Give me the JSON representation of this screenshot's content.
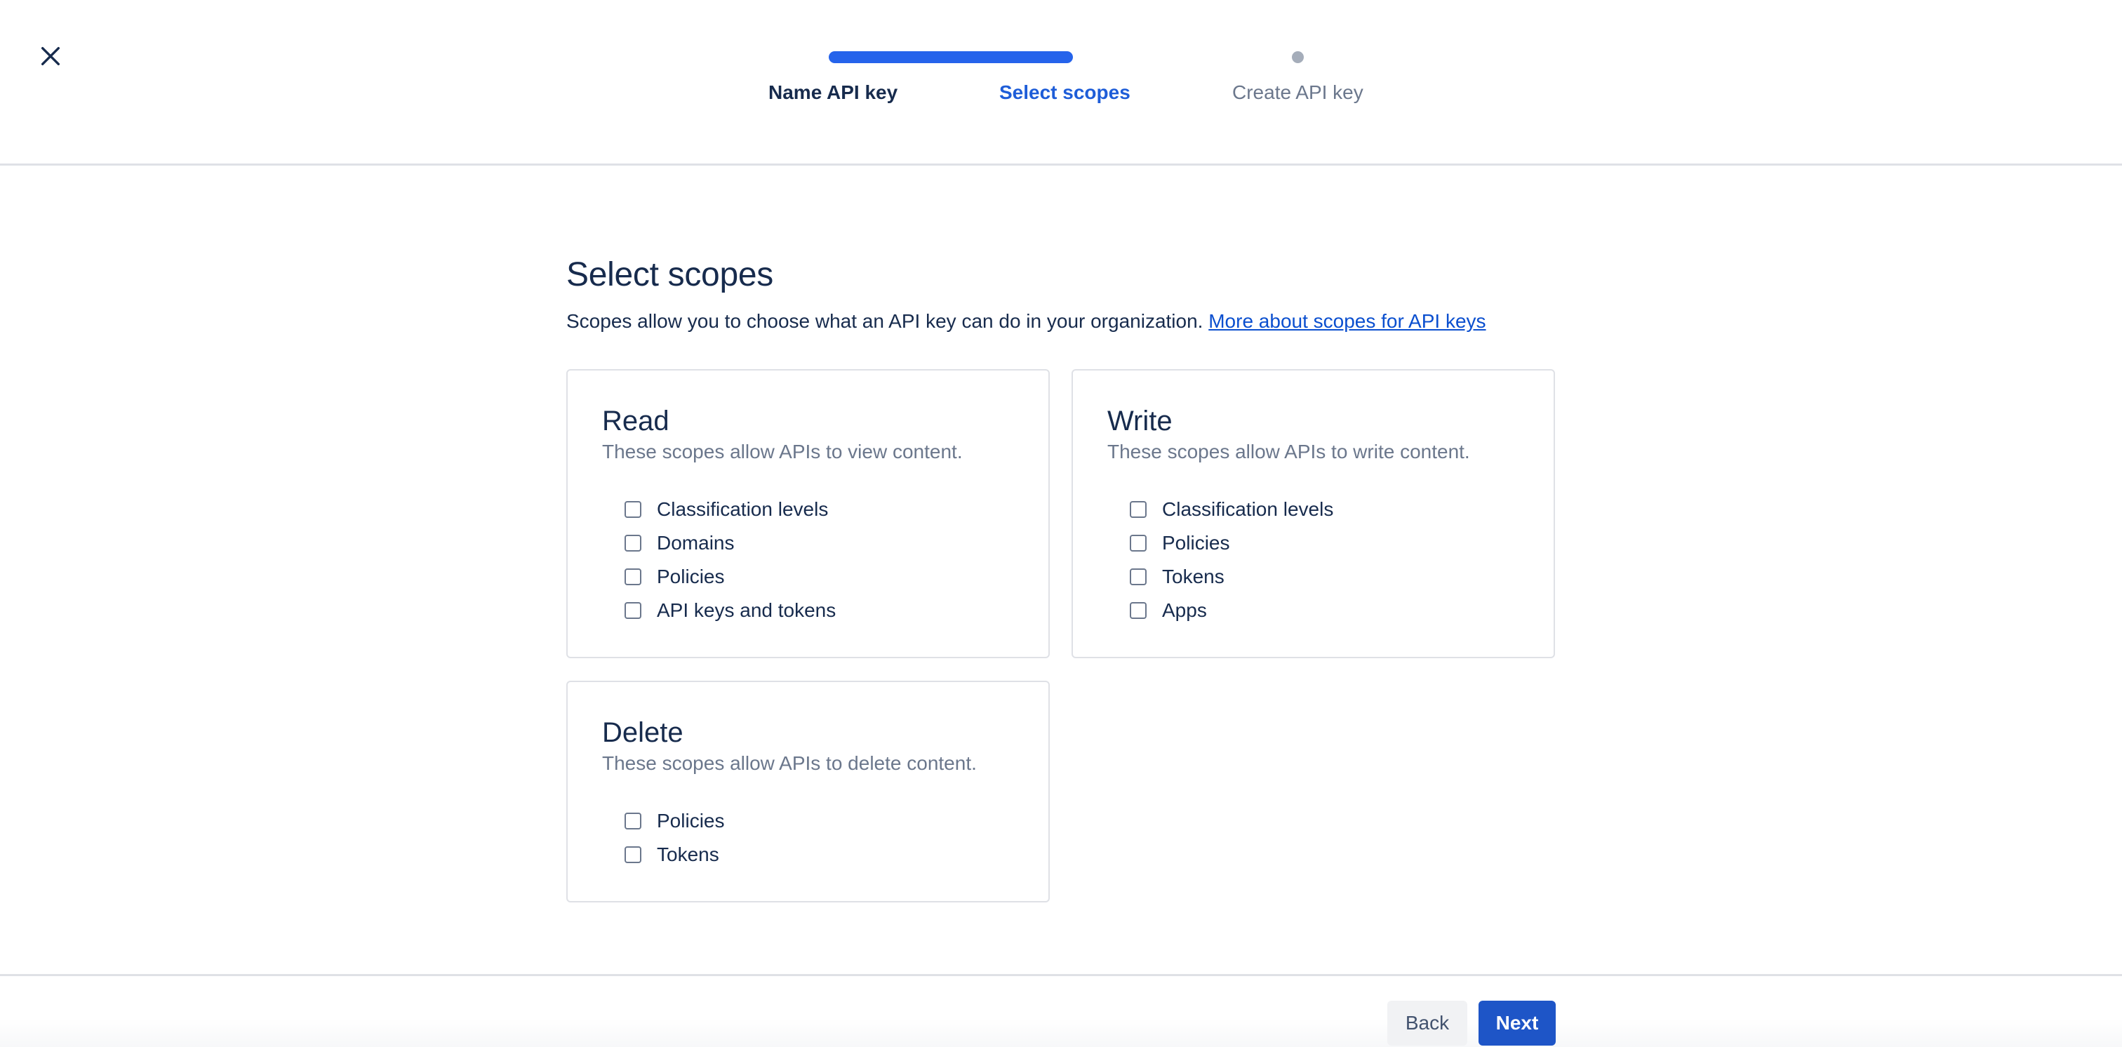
{
  "header": {
    "close_icon": "close-icon",
    "steps": [
      {
        "label": "Name API key",
        "state": "done"
      },
      {
        "label": "Select scopes",
        "state": "current"
      },
      {
        "label": "Create API key",
        "state": "todo"
      }
    ]
  },
  "main": {
    "title": "Select scopes",
    "intro": "Scopes allow you to choose what an API key can do in your organization.",
    "intro_link": "More about scopes for API keys",
    "sections": [
      {
        "title": "Read",
        "description": "These scopes allow APIs to view content.",
        "options": [
          {
            "label": "Classification levels",
            "checked": false
          },
          {
            "label": "Domains",
            "checked": false
          },
          {
            "label": "Policies",
            "checked": false
          },
          {
            "label": "API keys and tokens",
            "checked": false
          }
        ]
      },
      {
        "title": "Write",
        "description": "These scopes allow APIs to write content.",
        "options": [
          {
            "label": "Classification levels",
            "checked": false
          },
          {
            "label": "Policies",
            "checked": false
          },
          {
            "label": "Tokens",
            "checked": false
          },
          {
            "label": "Apps",
            "checked": false
          }
        ]
      },
      {
        "title": "Delete",
        "description": "These scopes allow APIs to delete content.",
        "options": [
          {
            "label": "Policies",
            "checked": false
          },
          {
            "label": "Tokens",
            "checked": false
          }
        ]
      }
    ]
  },
  "footer": {
    "back_label": "Back",
    "next_label": "Next"
  },
  "colors": {
    "accent": "#1e55c7",
    "progress": "#2563eb",
    "link": "#0b4fcf",
    "text": "#172b4d",
    "muted": "#6b778c",
    "border": "#dfe1e6"
  }
}
